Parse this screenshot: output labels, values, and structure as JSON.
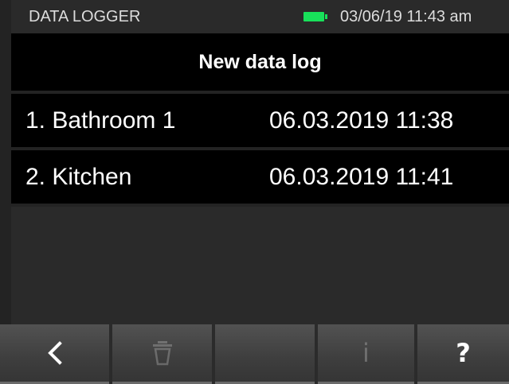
{
  "status_bar": {
    "title": "DATA LOGGER",
    "battery_color": "#18e05a",
    "datetime": "03/06/19 11:43 am"
  },
  "list": {
    "header": "New data log",
    "items": [
      {
        "name": "1. Bathroom 1",
        "timestamp": "06.03.2019 11:38"
      },
      {
        "name": "2. Kitchen",
        "timestamp": "06.03.2019 11:41"
      }
    ]
  },
  "softkeys": [
    {
      "icon": "back-arrow-icon",
      "enabled": true
    },
    {
      "icon": "trash-icon",
      "enabled": false
    },
    {
      "icon": "none",
      "enabled": false
    },
    {
      "icon": "info-icon",
      "enabled": false,
      "glyph": "i"
    },
    {
      "icon": "help-icon",
      "enabled": true,
      "glyph": "?"
    }
  ]
}
